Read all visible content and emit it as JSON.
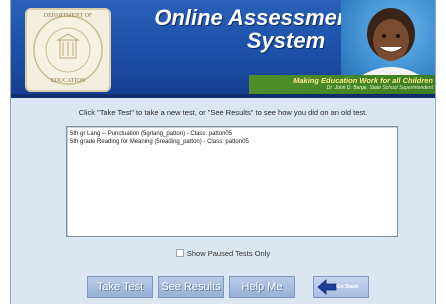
{
  "header": {
    "title_line1": "Online Assessment",
    "title_line2": "System",
    "seal_text_top": "DEPARTMENT OF",
    "seal_text_bottom": "EDUCATION",
    "tagline": "Making Education Work for all Children",
    "subtagline": "Dr. John D. Barge, State School Superintendent"
  },
  "main": {
    "instructions": "Click \"Take Test\" to take a new test, or \"See Results\" to see how you did on an old test.",
    "tests": [
      "5th gr Lang -- Punctuation (5grlang_patton) - Class: patton05",
      "5th grade Reading for Meaning (5reading_patton) - Class: patton05"
    ],
    "show_paused_label": "Show Paused Tests Only"
  },
  "buttons": {
    "take_test": "Take Test",
    "see_results": "See Results",
    "help_me": "Help Me",
    "go_back": "Go Back"
  },
  "icons": {
    "seal": "state-seal-icon",
    "go_back": "left-arrow-icon"
  },
  "colors": {
    "header_blue": "#1c4fa8",
    "tag_green": "#3c7d22",
    "tag_yellow": "#ffe98a",
    "panel_bg": "#dbe6f3",
    "button_bg": "#97b0d6"
  }
}
